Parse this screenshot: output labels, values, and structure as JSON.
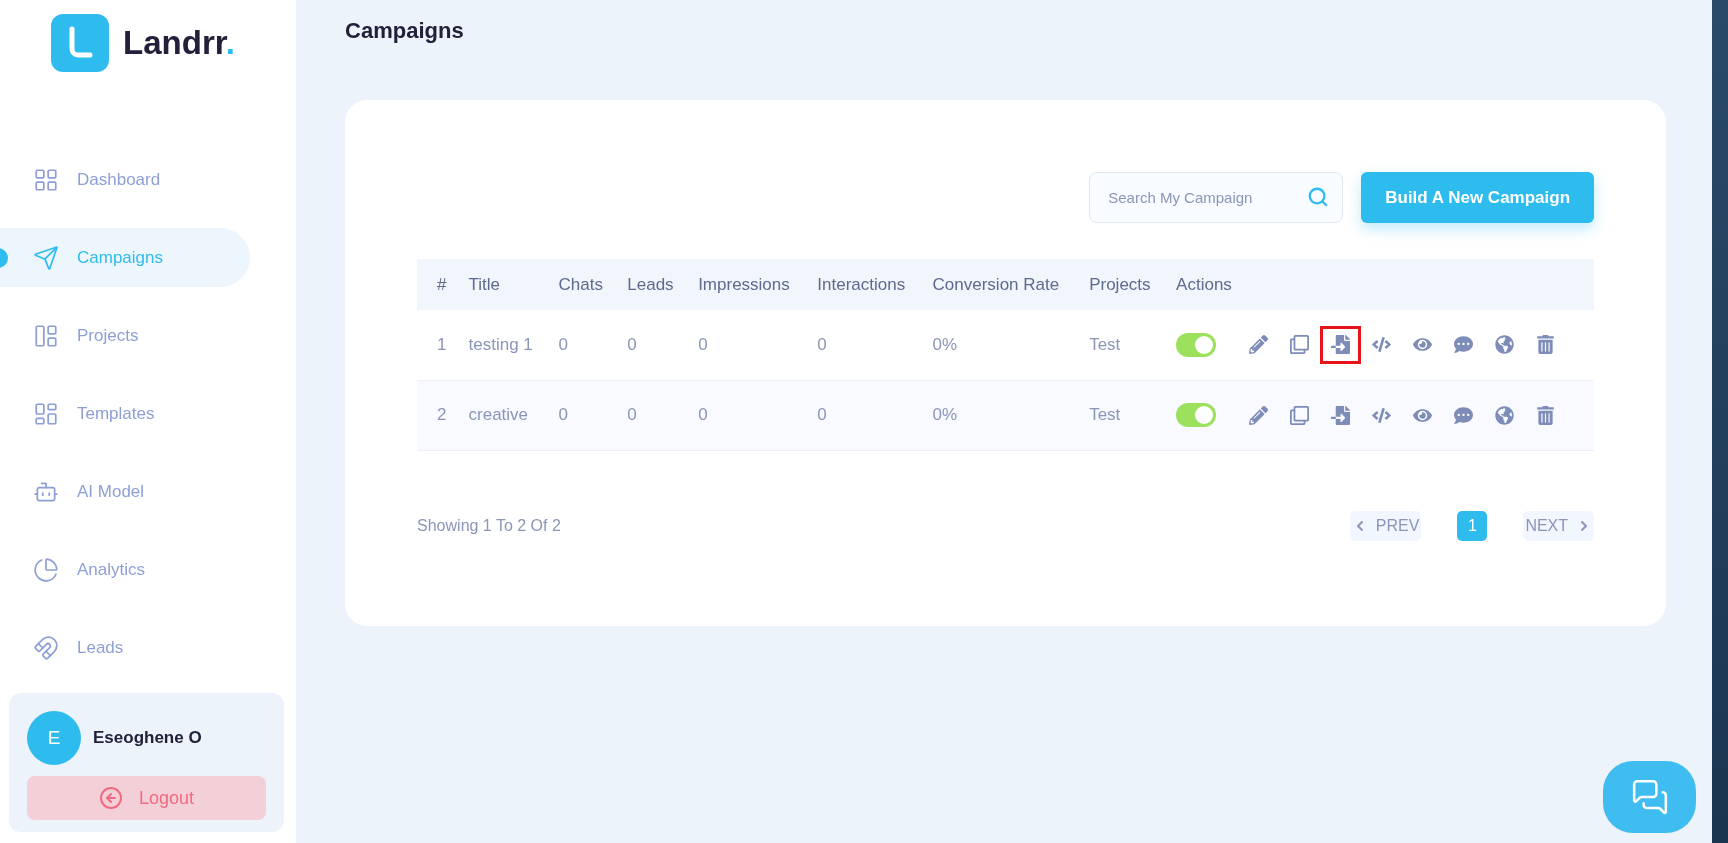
{
  "brand": {
    "name": "Landrr",
    "dot": "."
  },
  "sidebar": {
    "items": [
      {
        "label": "Dashboard",
        "selected": false
      },
      {
        "label": "Campaigns",
        "selected": true
      },
      {
        "label": "Projects",
        "selected": false
      },
      {
        "label": "Templates",
        "selected": false
      },
      {
        "label": "AI Model",
        "selected": false
      },
      {
        "label": "Analytics",
        "selected": false
      },
      {
        "label": "Leads",
        "selected": false
      }
    ]
  },
  "user": {
    "initial": "E",
    "name": "Eseoghene O",
    "logout": "Logout"
  },
  "page_title": "Campaigns",
  "search": {
    "placeholder": "Search My Campaign"
  },
  "build_button": "Build A New Campaign",
  "table": {
    "columns": [
      "#",
      "Title",
      "Chats",
      "Leads",
      "Impressions",
      "Interactions",
      "Conversion Rate",
      "Projects",
      "Actions"
    ],
    "rows": [
      {
        "cells": [
          "1",
          "testing 1",
          "0",
          "0",
          "0",
          "0",
          "0%",
          "Test"
        ],
        "on": true,
        "actions": [
          {
            "highlighted": false
          },
          {
            "highlighted": false
          },
          {
            "highlighted": true
          },
          {
            "highlighted": false
          },
          {
            "highlighted": false
          },
          {
            "highlighted": false
          },
          {
            "highlighted": false
          },
          {
            "highlighted": false
          }
        ]
      },
      {
        "cells": [
          "2",
          "creative",
          "0",
          "0",
          "0",
          "0",
          "0%",
          "Test"
        ],
        "on": true,
        "actions": [
          {
            "highlighted": false
          },
          {
            "highlighted": false
          },
          {
            "highlighted": false
          },
          {
            "highlighted": false
          },
          {
            "highlighted": false
          },
          {
            "highlighted": false
          },
          {
            "highlighted": false
          },
          {
            "highlighted": false
          }
        ]
      }
    ]
  },
  "footer": {
    "showing": "Showing 1 To 2 Of 2",
    "prev": "PREV",
    "next": "NEXT",
    "pages": [
      {
        "label": "1",
        "selected": true
      }
    ]
  }
}
